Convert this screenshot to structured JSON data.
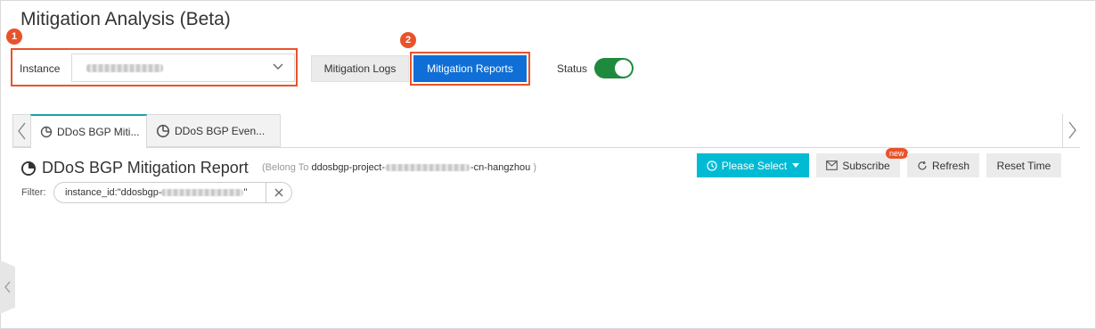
{
  "page": {
    "title": "Mitigation Analysis (Beta)"
  },
  "steps": {
    "one": "1",
    "two": "2"
  },
  "instance": {
    "label": "Instance",
    "value_redacted": true
  },
  "buttons": {
    "mitigation_logs": "Mitigation Logs",
    "mitigation_reports": "Mitigation Reports"
  },
  "status": {
    "label": "Status",
    "enabled": true
  },
  "tabs": [
    {
      "label": "DDoS BGP Miti...",
      "active": true
    },
    {
      "label": "DDoS BGP Even...",
      "active": false
    }
  ],
  "report": {
    "title": "DDoS BGP Mitigation Report",
    "belong_prefix": "(Belong To",
    "project_prefix": "ddosbgp-project-",
    "project_suffix": "-cn-hangzhou",
    "belong_close": ")"
  },
  "filter": {
    "label": "Filter:",
    "prefix": "instance_id:\"ddosbgp-",
    "suffix": "\""
  },
  "toolbar": {
    "please_select": "Please Select",
    "subscribe": "Subscribe",
    "new_badge": "new",
    "refresh": "Refresh",
    "reset_time": "Reset Time"
  },
  "colors": {
    "highlight": "#e8532b",
    "primary_blue": "#0f6fd6",
    "cyan": "#00bbd3",
    "toggle_green": "#1f8a3d",
    "tab_accent": "#1aa3a3"
  },
  "icons": [
    "chevron-down-icon",
    "chevron-left-icon",
    "chevron-right-icon",
    "pie-chart-icon",
    "clock-icon",
    "mail-icon",
    "refresh-icon",
    "close-icon"
  ]
}
